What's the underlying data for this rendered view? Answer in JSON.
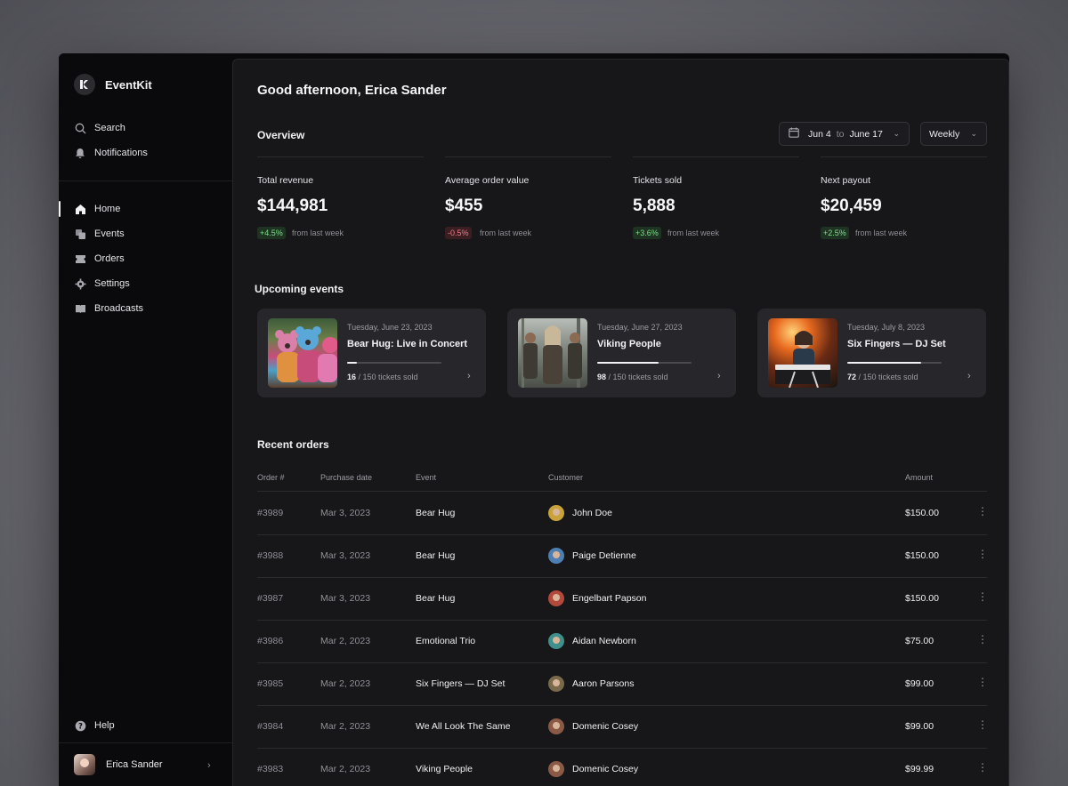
{
  "app": {
    "name": "EventKit"
  },
  "sidebar": {
    "search_label": "Search",
    "notifications_label": "Notifications",
    "nav": [
      {
        "label": "Home",
        "icon": "home-icon"
      },
      {
        "label": "Events",
        "icon": "events-icon"
      },
      {
        "label": "Orders",
        "icon": "ticket-icon"
      },
      {
        "label": "Settings",
        "icon": "gear-icon"
      },
      {
        "label": "Broadcasts",
        "icon": "book-icon"
      }
    ],
    "help_label": "Help",
    "user_name": "Erica Sander"
  },
  "header": {
    "greeting": "Good afternoon, Erica Sander"
  },
  "overview": {
    "title": "Overview",
    "date_from": "Jun 4",
    "date_sep": "to",
    "date_to": "June 17",
    "period": "Weekly",
    "stats": [
      {
        "label": "Total revenue",
        "value": "$144,981",
        "change": "+4.5%",
        "note": "from last week",
        "trend": "up"
      },
      {
        "label": "Average order value",
        "value": "$455",
        "change": "-0.5%",
        "note": "from last week",
        "trend": "down"
      },
      {
        "label": "Tickets sold",
        "value": "5,888",
        "change": "+3.6%",
        "note": "from last week",
        "trend": "up"
      },
      {
        "label": "Next payout",
        "value": "$20,459",
        "change": "+2.5%",
        "note": "from last week",
        "trend": "up"
      }
    ]
  },
  "upcoming": {
    "title": "Upcoming events",
    "events": [
      {
        "date": "Tuesday, June 23, 2023",
        "name": "Bear Hug: Live in Concert",
        "sold": "16",
        "sold_suffix": "/ 150 tickets sold",
        "progress": 0.107
      },
      {
        "date": "Tuesday, June 27, 2023",
        "name": "Viking People",
        "sold": "98",
        "sold_suffix": "/ 150 tickets sold",
        "progress": 0.653
      },
      {
        "date": "Tuesday, July 8, 2023",
        "name": "Six Fingers — DJ Set",
        "sold": "72",
        "sold_suffix": "/ 150 tickets sold",
        "progress": 0.78
      }
    ]
  },
  "orders": {
    "title": "Recent orders",
    "columns": {
      "order": "Order #",
      "date": "Purchase date",
      "event": "Event",
      "customer": "Customer",
      "amount": "Amount"
    },
    "rows": [
      {
        "id": "#3989",
        "date": "Mar 3, 2023",
        "event": "Bear Hug",
        "customer": "John Doe",
        "amount": "$150.00",
        "avatar_color": "#c9a23a"
      },
      {
        "id": "#3988",
        "date": "Mar 3, 2023",
        "event": "Bear Hug",
        "customer": "Paige Detienne",
        "amount": "$150.00",
        "avatar_color": "#4d7fb3"
      },
      {
        "id": "#3987",
        "date": "Mar 3, 2023",
        "event": "Bear Hug",
        "customer": "Engelbart Papson",
        "amount": "$150.00",
        "avatar_color": "#b3483d"
      },
      {
        "id": "#3986",
        "date": "Mar 2, 2023",
        "event": "Emotional Trio",
        "customer": "Aidan Newborn",
        "amount": "$75.00",
        "avatar_color": "#3f8f8a"
      },
      {
        "id": "#3985",
        "date": "Mar 2, 2023",
        "event": "Six Fingers — DJ Set",
        "customer": "Aaron Parsons",
        "amount": "$99.00",
        "avatar_color": "#7a6a4c"
      },
      {
        "id": "#3984",
        "date": "Mar 2, 2023",
        "event": "We All Look The Same",
        "customer": "Domenic Cosey",
        "amount": "$99.00",
        "avatar_color": "#8a5a46"
      },
      {
        "id": "#3983",
        "date": "Mar 2, 2023",
        "event": "Viking People",
        "customer": "Domenic Cosey",
        "amount": "$99.99",
        "avatar_color": "#8a5a46"
      }
    ]
  },
  "colors": {
    "positive": "#7edc8a",
    "negative": "#f07c86",
    "accent": "#f2f2f4"
  }
}
